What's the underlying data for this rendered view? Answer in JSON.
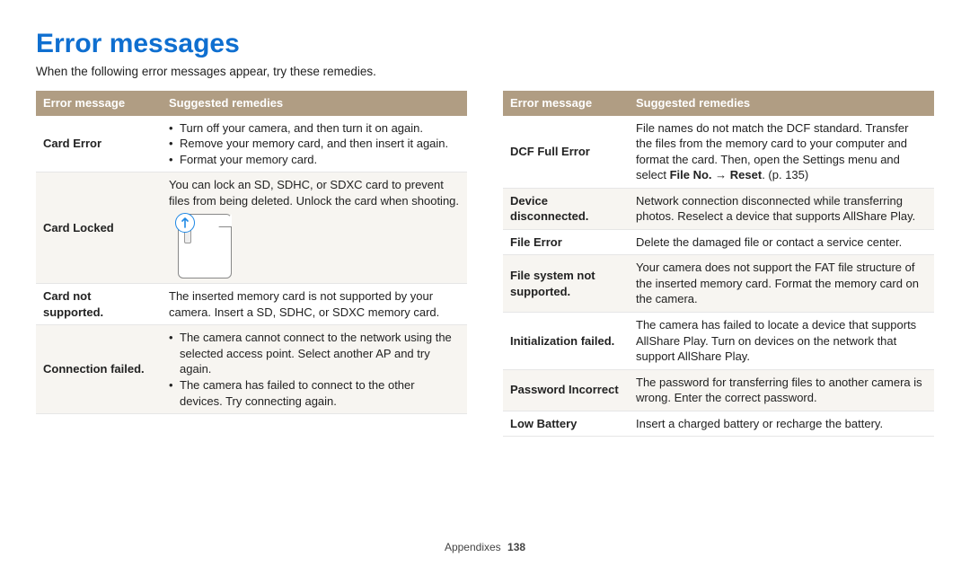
{
  "title": "Error messages",
  "intro": "When the following error messages appear, try these remedies.",
  "headers": {
    "col1": "Error message",
    "col2": "Suggested remedies"
  },
  "left": [
    {
      "err": "Card Error",
      "remedies": [
        "Turn off your camera, and then turn it on again.",
        "Remove your memory card, and then insert it again.",
        "Format your memory card."
      ]
    },
    {
      "err": "Card Locked",
      "text": "You can lock an SD, SDHC, or SDXC card to prevent files from being deleted. Unlock the card when shooting.",
      "hasImage": true
    },
    {
      "err": "Card not supported.",
      "text": "The inserted memory card is not supported by your camera. Insert a SD, SDHC, or SDXC memory card."
    },
    {
      "err": "Connection failed.",
      "remedies": [
        "The camera cannot connect to the network using the selected access point. Select another AP and try again.",
        "The camera has failed to connect to the other devices. Try connecting again."
      ]
    }
  ],
  "right": [
    {
      "err": "DCF Full Error",
      "text_pre": "File names do not match the DCF standard. Transfer the files from the memory card to your computer and format the card. Then, open the Settings menu and select ",
      "bold1": "File No.",
      "arrow": " → ",
      "bold2": "Reset",
      "text_post": ". (p. 135)"
    },
    {
      "err": "Device disconnected.",
      "text": "Network connection disconnected while transferring photos. Reselect a device that supports AllShare Play."
    },
    {
      "err": "File Error",
      "text": "Delete the damaged file or contact a service center."
    },
    {
      "err": "File system not supported.",
      "text": "Your camera does not support the FAT file structure of the inserted memory card. Format the memory card on the camera."
    },
    {
      "err": "Initialization failed.",
      "text": "The camera has failed to locate a device that supports AllShare Play. Turn on devices on the network that support AllShare Play."
    },
    {
      "err": "Password Incorrect",
      "text": "The password for transferring files to another camera is wrong. Enter the correct password."
    },
    {
      "err": "Low Battery",
      "text": "Insert a charged battery or recharge the battery."
    }
  ],
  "footer": {
    "section": "Appendixes",
    "page": "138"
  }
}
